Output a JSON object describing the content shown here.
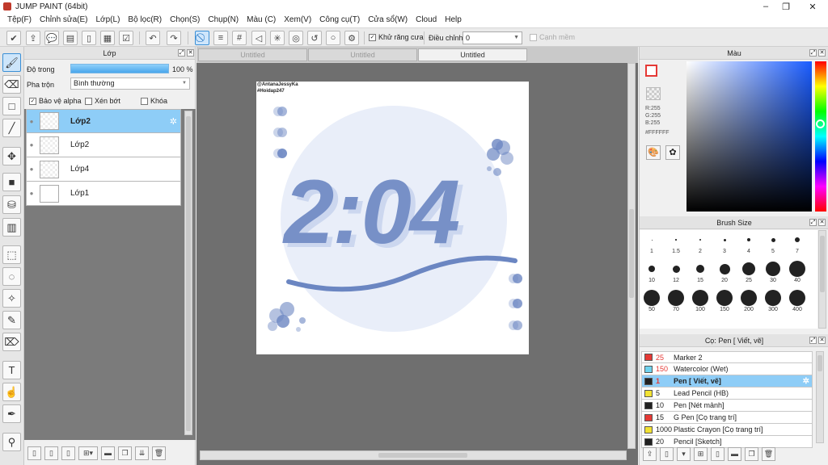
{
  "window": {
    "title": "JUMP PAINT (64bit)",
    "controls": {
      "minimize": "–",
      "maximize": "❐",
      "close": "✕"
    }
  },
  "menu": [
    "Tệp(F)",
    "Chỉnh sửa(E)",
    "Lớp(L)",
    "Bộ lọc(R)",
    "Chọn(S)",
    "Chụp(N)",
    "Màu (C)",
    "Xem(V)",
    "Công cụ(T)",
    "Cửa sổ(W)",
    "Cloud",
    "Help"
  ],
  "toolbar": {
    "antialias_label": "Khử răng cưa",
    "adjust_label": "Điều chỉnh",
    "adjust_value": "0",
    "snap_label": "Cạnh mềm",
    "icons": [
      "check-circle-icon",
      "export-icon",
      "speech-bubble-icon",
      "comment-icon",
      "page-icon",
      "panel-icon",
      "checklist-icon",
      "undo-icon",
      "redo-icon",
      "no-snap-icon",
      "parallel-lines-icon",
      "grid-icon",
      "perspective-icon",
      "radial-icon",
      "concentric-icon",
      "curve-icon",
      "circle-icon",
      "gear-ruler-icon"
    ]
  },
  "layer_panel": {
    "title": "Lớp",
    "opacity_label": "Độ trong",
    "opacity_value": "100 %",
    "opacity_fraction": 1.0,
    "blend_label": "Pha trộn",
    "blend_value": "Bình thường",
    "protect_alpha_label": "Bảo vệ alpha",
    "clip_label": "Xén bớt",
    "lock_label": "Khóa",
    "layers": [
      {
        "name": "Lớp2",
        "selected": true
      },
      {
        "name": "Lớp2",
        "selected": false
      },
      {
        "name": "Lớp4",
        "selected": false
      },
      {
        "name": "Lớp1",
        "selected": false
      }
    ]
  },
  "doc_tabs": [
    "Untitled",
    "Untitled",
    "Untitled"
  ],
  "artwork": {
    "credit_line1": "@AntanaJessyKa",
    "credit_line2": "#Hoidap247",
    "big_text": "2:04",
    "color_main": "#6b86c2",
    "color_light": "#e9eef9"
  },
  "color_panel": {
    "title": "Màu",
    "r": "R:255",
    "g": "G:255",
    "b": "B:255",
    "hex": "#FFFFFF"
  },
  "brush_size_panel": {
    "title": "Brush Size",
    "sizes": [
      "1",
      "1.5",
      "2",
      "3",
      "4",
      "5",
      "7",
      "10",
      "12",
      "15",
      "20",
      "25",
      "30",
      "40",
      "50",
      "70",
      "100",
      "150",
      "200",
      "300",
      "400"
    ]
  },
  "brush_panel": {
    "title": "Cọ: Pen [ Viết, vẽ]",
    "brushes": [
      {
        "size": "25",
        "name": "Marker 2",
        "color": "#e53935",
        "size_color": "#e53935",
        "selected": false
      },
      {
        "size": "150",
        "name": "Watercolor (Wet)",
        "color": "#6fd3ef",
        "size_color": "#e53935",
        "selected": false
      },
      {
        "size": "1",
        "name": "Pen [ Viết, vẽ]",
        "color": "#222222",
        "size_color": "#e53935",
        "selected": true
      },
      {
        "size": "5",
        "name": "Lead Pencil (HB)",
        "color": "#f2e233",
        "size_color": "#222222",
        "selected": false
      },
      {
        "size": "10",
        "name": "Pen [Nét mảnh]",
        "color": "#222222",
        "size_color": "#222222",
        "selected": false
      },
      {
        "size": "15",
        "name": "G Pen [Cọ trang trí]",
        "color": "#e53935",
        "size_color": "#222222",
        "selected": false
      },
      {
        "size": "1000",
        "name": "Plastic Crayon [Cọ trang trí]",
        "color": "#f2e233",
        "size_color": "#222222",
        "selected": false
      },
      {
        "size": "20",
        "name": "Pencil [Sketch]",
        "color": "#222222",
        "size_color": "#222222",
        "selected": false
      }
    ]
  }
}
